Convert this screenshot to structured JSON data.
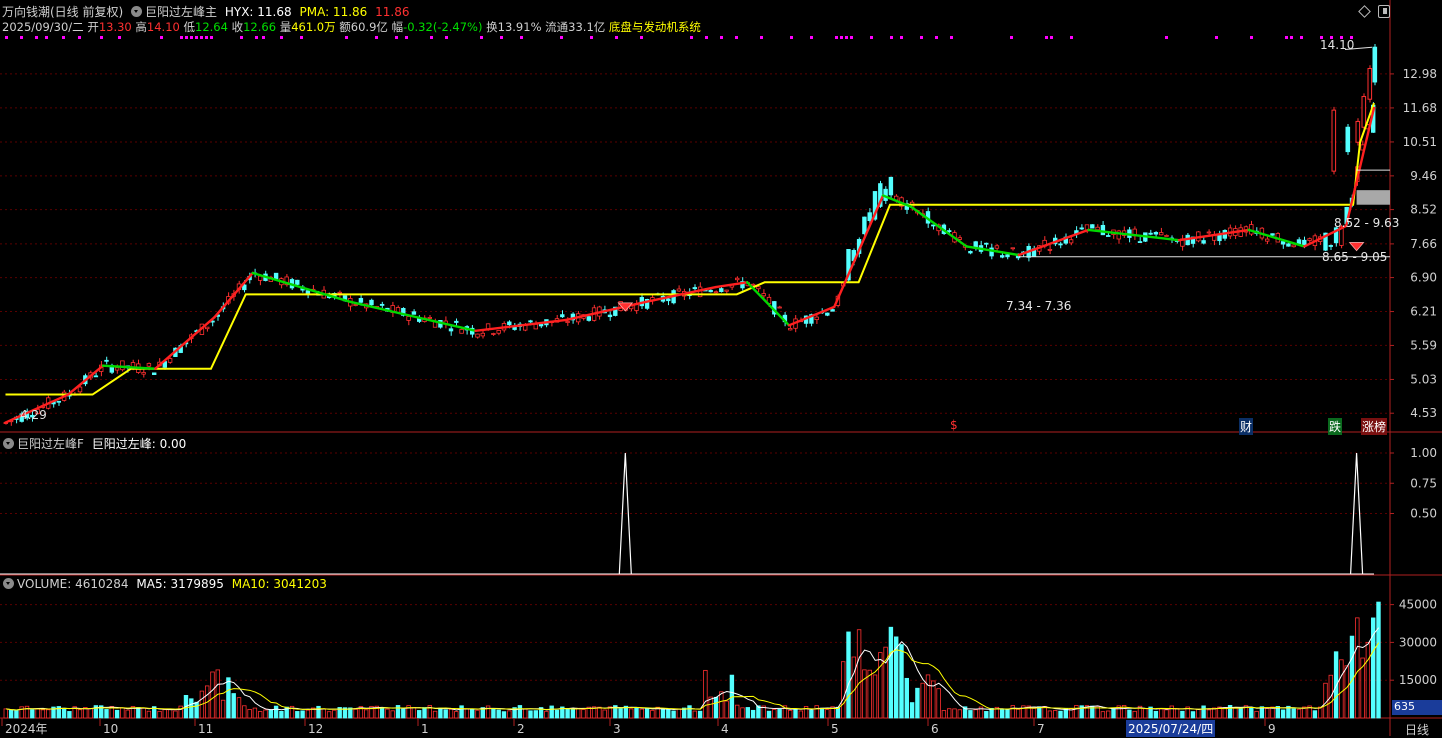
{
  "header": {
    "stock_title": "万向钱潮(日线 前复权)",
    "indicator_name": "巨阳过左峰主",
    "hyx_label": "HYX: 11.68",
    "pma_label": "PMA: 11.86",
    "extra_label": "11.86",
    "date": "2025/09/30/二",
    "open_label": "开",
    "open": "13.30",
    "high_label": "高",
    "high": "14.10",
    "low_label": "低",
    "low": "12.64",
    "close_label": "收",
    "close": "12.66",
    "vol_label": "量",
    "vol": "461.0万",
    "amt_label": "额",
    "amt": "60.9亿",
    "chg_label": "幅",
    "chg": "-0.32(-2.47%)",
    "turn_label": "换",
    "turn": "13.91%",
    "float_label": "流通",
    "float": "33.1亿",
    "system_label": "底盘与发动机系统"
  },
  "price_panel": {
    "y_ticks": [
      "12.98",
      "11.68",
      "10.51",
      "9.46",
      "8.52",
      "7.66",
      "6.90",
      "6.21",
      "5.59",
      "5.03",
      "4.53"
    ],
    "max_label": "14.10",
    "min_label": "4.29",
    "box_labels": [
      "8.52 - 9.63",
      "8.65 - 9.05",
      "7.34 - 7.36"
    ],
    "events": [
      {
        "text": "$",
        "color": "#ff3030"
      },
      {
        "text": "财",
        "color": "#6f9fff"
      },
      {
        "text": "跌",
        "color": "#00e000"
      },
      {
        "text": "涨榜",
        "color": "#ff5050"
      }
    ],
    "colors": {
      "line_up": "#ff2020",
      "line_down": "#00d800",
      "level": "#ffff00",
      "box": "#a8a8a8",
      "dots": "#ff00ff"
    }
  },
  "indicator_panel": {
    "title": "巨阳过左峰F",
    "value_label": "巨阳过左峰: 0.00",
    "y_ticks": [
      "1.00",
      "0.75",
      "0.50"
    ],
    "spike_dates": [
      "2025/02/27",
      "2025/09/25"
    ]
  },
  "volume_panel": {
    "title": "VOLUME: 4610284",
    "ma5": "MA5: 3179895",
    "ma10": "MA10: 3041203",
    "y_ticks": [
      "45000",
      "30000",
      "15000"
    ],
    "corner_value": "635"
  },
  "x_axis": {
    "labels": [
      "2024年",
      "10",
      "11",
      "12",
      "1",
      "2",
      "3",
      "4",
      "5",
      "6",
      "7",
      "8",
      "9"
    ],
    "cursor_date": "2025/07/24/四",
    "period": "日线"
  },
  "window_buttons": {
    "diamond": "diamond-icon",
    "restore": "restore-icon"
  },
  "chart_data": {
    "type": "line",
    "title": "万向钱潮(日线 前复权)",
    "series": [
      {
        "name": "HYX",
        "points": [
          [
            "2024-09-02",
            4.4
          ],
          [
            "2024-09-20",
            4.8
          ],
          [
            "2024-09-30",
            5.25
          ],
          [
            "2024-10-15",
            5.2
          ],
          [
            "2024-11-01",
            6.1
          ],
          [
            "2024-11-12",
            7.0
          ],
          [
            "2024-12-10",
            6.4
          ],
          [
            "2025-01-15",
            5.85
          ],
          [
            "2025-02-10",
            6.05
          ],
          [
            "2025-03-05",
            6.4
          ],
          [
            "2025-03-25",
            6.7
          ],
          [
            "2025-04-03",
            6.8
          ],
          [
            "2025-04-15",
            5.95
          ],
          [
            "2025-04-28",
            6.3
          ],
          [
            "2025-05-12",
            8.9
          ],
          [
            "2025-05-20",
            8.6
          ],
          [
            "2025-06-05",
            7.6
          ],
          [
            "2025-06-20",
            7.4
          ],
          [
            "2025-07-10",
            8.0
          ],
          [
            "2025-08-05",
            7.75
          ],
          [
            "2025-08-25",
            8.0
          ],
          [
            "2025-09-10",
            7.6
          ],
          [
            "2025-09-22",
            8.1
          ],
          [
            "2025-09-30",
            11.68
          ]
        ]
      },
      {
        "name": "PMA",
        "points": [
          [
            "2024-09-02",
            4.8
          ],
          [
            "2024-09-27",
            4.8
          ],
          [
            "2024-10-08",
            5.2
          ],
          [
            "2024-10-31",
            5.2
          ],
          [
            "2024-11-10",
            6.55
          ],
          [
            "2025-03-31",
            6.55
          ],
          [
            "2025-04-08",
            6.8
          ],
          [
            "2025-05-05",
            6.8
          ],
          [
            "2025-05-14",
            8.65
          ],
          [
            "2025-09-24",
            8.65
          ],
          [
            "2025-09-26",
            10.5
          ],
          [
            "2025-09-30",
            11.86
          ]
        ]
      }
    ],
    "candles": {
      "high_max": 14.1,
      "low_min": 4.29,
      "last": {
        "open": 13.3,
        "high": 14.1,
        "low": 12.64,
        "close": 12.66
      }
    },
    "volume_ylim": [
      0,
      50000
    ],
    "price_ylim_log": [
      4.3,
      14.6
    ]
  }
}
